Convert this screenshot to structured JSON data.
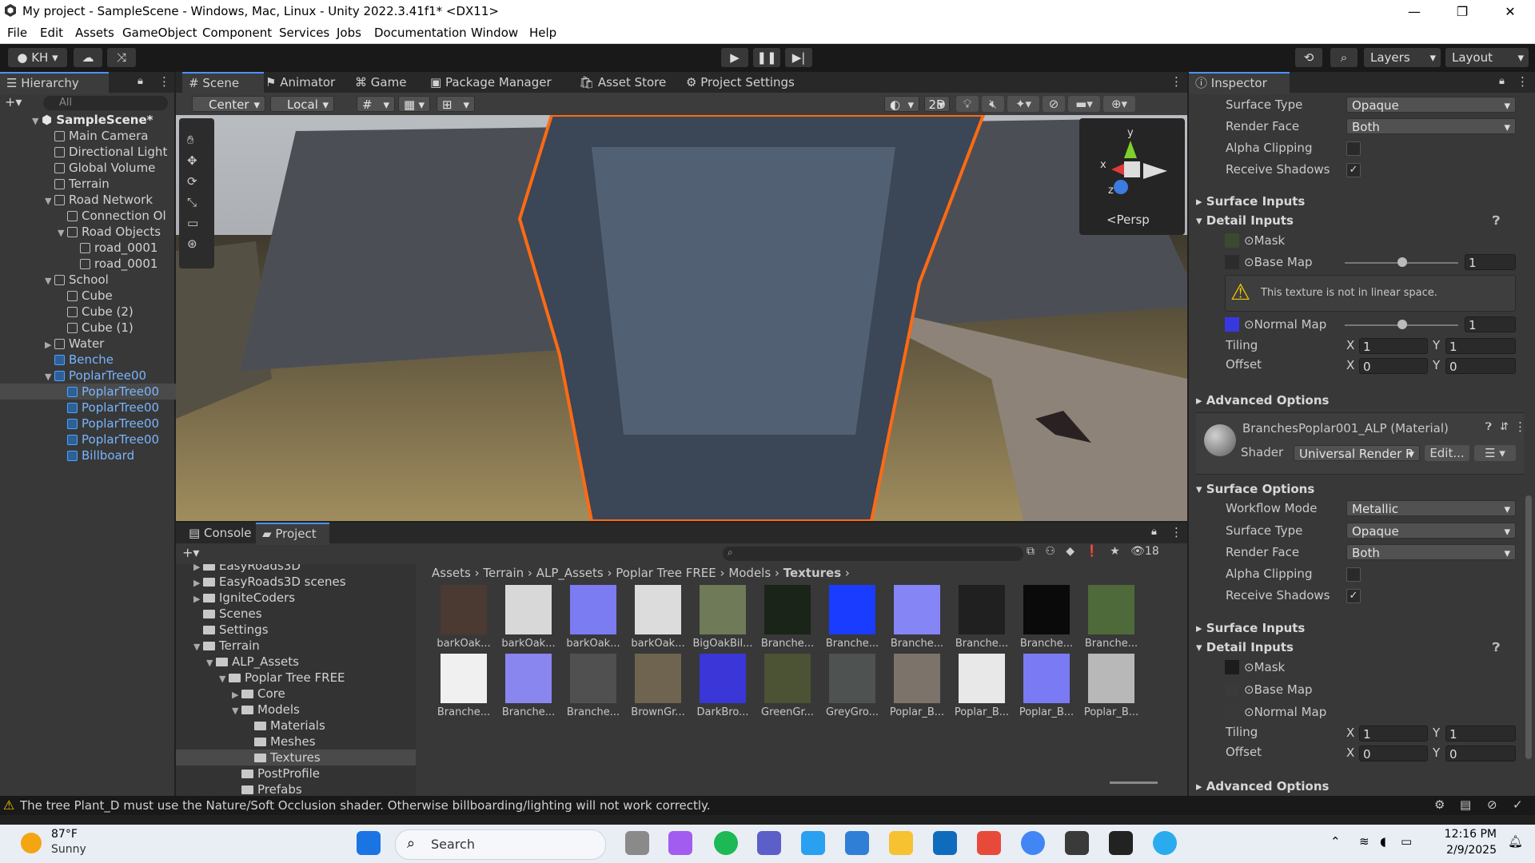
{
  "window": {
    "title": "My project - SampleScene - Windows, Mac, Linux - Unity 2022.3.41f1* <DX11>",
    "minimize": "—",
    "maximize": "❐",
    "close": "✕"
  },
  "menu": [
    "File",
    "Edit",
    "Assets",
    "GameObject",
    "Component",
    "Services",
    "Jobs",
    "Documentation",
    "Window",
    "Help"
  ],
  "toolbar": {
    "account": "KH",
    "layers": "Layers",
    "layout": "Layout"
  },
  "hierarchy": {
    "tab": "Hierarchy",
    "search_placeholder": "All",
    "scene": "SampleScene*",
    "items": [
      {
        "label": "Main Camera",
        "depth": 1,
        "blue": false,
        "arrow": ""
      },
      {
        "label": "Directional Light",
        "depth": 1,
        "blue": false,
        "arrow": ""
      },
      {
        "label": "Global Volume",
        "depth": 1,
        "blue": false,
        "arrow": ""
      },
      {
        "label": "Terrain",
        "depth": 1,
        "blue": false,
        "arrow": ""
      },
      {
        "label": "Road Network",
        "depth": 1,
        "blue": false,
        "arrow": "▼"
      },
      {
        "label": "Connection Ol",
        "depth": 2,
        "blue": false,
        "arrow": ""
      },
      {
        "label": "Road Objects",
        "depth": 2,
        "blue": false,
        "arrow": "▼"
      },
      {
        "label": "road_0001",
        "depth": 3,
        "blue": false,
        "arrow": ""
      },
      {
        "label": "road_0001",
        "depth": 3,
        "blue": false,
        "arrow": ""
      },
      {
        "label": "School",
        "depth": 1,
        "blue": false,
        "arrow": "▼"
      },
      {
        "label": "Cube",
        "depth": 2,
        "blue": false,
        "arrow": ""
      },
      {
        "label": "Cube (2)",
        "depth": 2,
        "blue": false,
        "arrow": ""
      },
      {
        "label": "Cube (1)",
        "depth": 2,
        "blue": false,
        "arrow": ""
      },
      {
        "label": "Water",
        "depth": 1,
        "blue": false,
        "arrow": "▶"
      },
      {
        "label": "Benche",
        "depth": 1,
        "blue": true,
        "arrow": ""
      },
      {
        "label": "PoplarTree00",
        "depth": 1,
        "blue": true,
        "arrow": "▼"
      },
      {
        "label": "PoplarTree00",
        "depth": 2,
        "blue": true,
        "arrow": ""
      },
      {
        "label": "PoplarTree00",
        "depth": 2,
        "blue": true,
        "arrow": ""
      },
      {
        "label": "PoplarTree00",
        "depth": 2,
        "blue": true,
        "arrow": ""
      },
      {
        "label": "PoplarTree00",
        "depth": 2,
        "blue": true,
        "arrow": ""
      },
      {
        "label": "Billboard",
        "depth": 2,
        "blue": true,
        "arrow": ""
      }
    ]
  },
  "scene_tabs": [
    "Scene",
    "Animator",
    "Game",
    "Package Manager",
    "Asset Store",
    "Project Settings"
  ],
  "scene_toolbar": {
    "pivot": "Center",
    "space": "Local",
    "mode2d": "2D",
    "persp": "Persp"
  },
  "bottom_tabs": [
    "Console",
    "Project"
  ],
  "project": {
    "hidden_count": "18",
    "tree": [
      {
        "label": "EasyRoads3D",
        "depth": 1,
        "arrow": "▶"
      },
      {
        "label": "EasyRoads3D scenes",
        "depth": 1,
        "arrow": "▶"
      },
      {
        "label": "IgniteCoders",
        "depth": 1,
        "arrow": "▶"
      },
      {
        "label": "Scenes",
        "depth": 1,
        "arrow": ""
      },
      {
        "label": "Settings",
        "depth": 1,
        "arrow": ""
      },
      {
        "label": "Terrain",
        "depth": 1,
        "arrow": "▼"
      },
      {
        "label": "ALP_Assets",
        "depth": 2,
        "arrow": "▼"
      },
      {
        "label": "Poplar Tree FREE",
        "depth": 3,
        "arrow": "▼"
      },
      {
        "label": "Core",
        "depth": 4,
        "arrow": "▶"
      },
      {
        "label": "Models",
        "depth": 4,
        "arrow": "▼"
      },
      {
        "label": "Materials",
        "depth": 5,
        "arrow": ""
      },
      {
        "label": "Meshes",
        "depth": 5,
        "arrow": ""
      },
      {
        "label": "Textures",
        "depth": 5,
        "arrow": ""
      },
      {
        "label": "PostProfile",
        "depth": 4,
        "arrow": ""
      },
      {
        "label": "Prefabs",
        "depth": 4,
        "arrow": ""
      }
    ],
    "breadcrumb": [
      "Assets",
      "Terrain",
      "ALP_Assets",
      "Poplar Tree FREE",
      "Models",
      "Textures"
    ],
    "assets": [
      {
        "label": "barkOak...",
        "color": "#4a3a32"
      },
      {
        "label": "barkOak...",
        "color": "#d8d8d8"
      },
      {
        "label": "barkOak...",
        "color": "#7b7bf2"
      },
      {
        "label": "barkOak...",
        "color": "#dcdcdc"
      },
      {
        "label": "BigOakBil...",
        "color": "#6e7a58"
      },
      {
        "label": "Branche...",
        "color": "#1a2418"
      },
      {
        "label": "Branche...",
        "color": "#1a3cff"
      },
      {
        "label": "Branche...",
        "color": "#8585f5"
      },
      {
        "label": "Branche...",
        "color": "#202020"
      },
      {
        "label": "Branche...",
        "color": "#0a0a0a"
      },
      {
        "label": "Branche...",
        "color": "#4f6a3a"
      },
      {
        "label": "Branche...",
        "color": "#f0f0f0"
      },
      {
        "label": "Branche...",
        "color": "#8a86f0"
      },
      {
        "label": "Branche...",
        "color": "#505050"
      },
      {
        "label": "BrownGr...",
        "color": "#6e6450"
      },
      {
        "label": "DarkBro...",
        "color": "#3a36d8"
      },
      {
        "label": "GreenGr...",
        "color": "#4c5234"
      },
      {
        "label": "GreyGro...",
        "color": "#4e5250"
      },
      {
        "label": "Poplar_B...",
        "color": "#7c746a"
      },
      {
        "label": "Poplar_B...",
        "color": "#e8e8e8"
      },
      {
        "label": "Poplar_B...",
        "color": "#7a7af4"
      },
      {
        "label": "Poplar_B...",
        "color": "#b8b8b8"
      }
    ]
  },
  "inspector": {
    "tab": "Inspector",
    "top": {
      "surface_type_label": "Surface Type",
      "surface_type": "Opaque",
      "render_face_label": "Render Face",
      "render_face": "Both",
      "alpha_clipping_label": "Alpha Clipping",
      "receive_shadows_label": "Receive Shadows"
    },
    "surface_inputs": "Surface Inputs",
    "detail_inputs": "Detail Inputs",
    "mask": "Mask",
    "base_map": "Base Map",
    "base_map_value": "1",
    "warning": "This texture is not in linear space.",
    "normal_map": "Normal Map",
    "normal_map_value": "1",
    "tiling": "Tiling",
    "offset": "Offset",
    "x": "X",
    "y": "Y",
    "tiling_x": "1",
    "tiling_y": "1",
    "offset_x": "0",
    "offset_y": "0",
    "advanced_options": "Advanced Options",
    "material_name": "BranchesPoplar001_ALP (Material)",
    "shader_label": "Shader",
    "shader": "Universal Render P",
    "edit": "Edit...",
    "surface_options": "Surface Options",
    "workflow_mode_label": "Workflow Mode",
    "workflow_mode": "Metallic"
  },
  "status": {
    "message": "The tree Plant_D must use the Nature/Soft Occlusion shader. Otherwise billboarding/lighting will not work correctly."
  },
  "taskbar": {
    "weather_temp": "87°F",
    "weather_desc": "Sunny",
    "search": "Search",
    "time": "12:16 PM",
    "date": "2/9/2025"
  }
}
